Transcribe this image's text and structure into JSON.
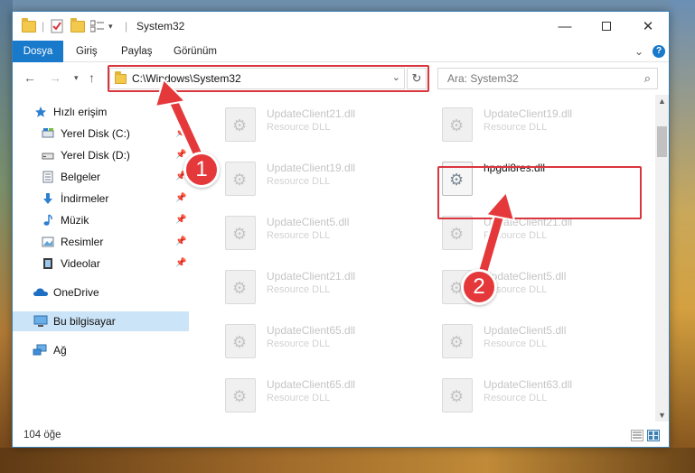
{
  "window": {
    "title": "System32"
  },
  "ribbon": {
    "tabs": [
      "Dosya",
      "Giriş",
      "Paylaş",
      "Görünüm"
    ]
  },
  "navigation": {
    "address": "C:\\Windows\\System32",
    "search_placeholder": "Ara: System32"
  },
  "sidebar": {
    "items": [
      {
        "label": "Hızlı erişim",
        "icon": "star-icon"
      },
      {
        "label": "Yerel Disk (C:)",
        "icon": "drive-icon",
        "pinned": true
      },
      {
        "label": "Yerel Disk (D:)",
        "icon": "drive-icon",
        "pinned": true
      },
      {
        "label": "Belgeler",
        "icon": "documents-icon",
        "pinned": true
      },
      {
        "label": "İndirmeler",
        "icon": "download-icon",
        "pinned": true
      },
      {
        "label": "Müzik",
        "icon": "music-icon",
        "pinned": true
      },
      {
        "label": "Resimler",
        "icon": "pictures-icon",
        "pinned": true
      },
      {
        "label": "Videolar",
        "icon": "videos-icon",
        "pinned": true
      },
      {
        "label": "OneDrive",
        "icon": "cloud-icon"
      },
      {
        "label": "Bu bilgisayar",
        "icon": "computer-icon",
        "selected": true
      },
      {
        "label": "Ağ",
        "icon": "network-icon"
      }
    ]
  },
  "files": {
    "left_column": [
      {
        "name": "UpdateClient21.dll",
        "type": "Resource DLL"
      },
      {
        "name": "UpdateClient19.dll",
        "type": "Resource DLL"
      },
      {
        "name": "UpdateClient5.dll",
        "type": "Resource DLL"
      },
      {
        "name": "UpdateClient21.dll",
        "type": "Resource DLL"
      },
      {
        "name": "UpdateClient65.dll",
        "type": "Resource DLL"
      },
      {
        "name": "UpdateClient65.dll",
        "type": "Resource DLL"
      }
    ],
    "right_column": [
      {
        "name": "UpdateClient19.dll",
        "type": "Resource DLL"
      },
      {
        "name": "hpgdi8res.dll",
        "type": ""
      },
      {
        "name": "UpdateClient21.dll",
        "type": "Resource DLL"
      },
      {
        "name": "UpdateClient5.dll",
        "type": "Resource DLL"
      },
      {
        "name": "UpdateClient5.dll",
        "type": "Resource DLL"
      },
      {
        "name": "UpdateClient63.dll",
        "type": "Resource DLL"
      }
    ]
  },
  "status": {
    "item_count": "104 öğe"
  },
  "callouts": {
    "step1": "1",
    "step2": "2"
  },
  "colors": {
    "accent": "#1979ca",
    "highlight": "#d9363e",
    "callout": "#e5383b"
  }
}
